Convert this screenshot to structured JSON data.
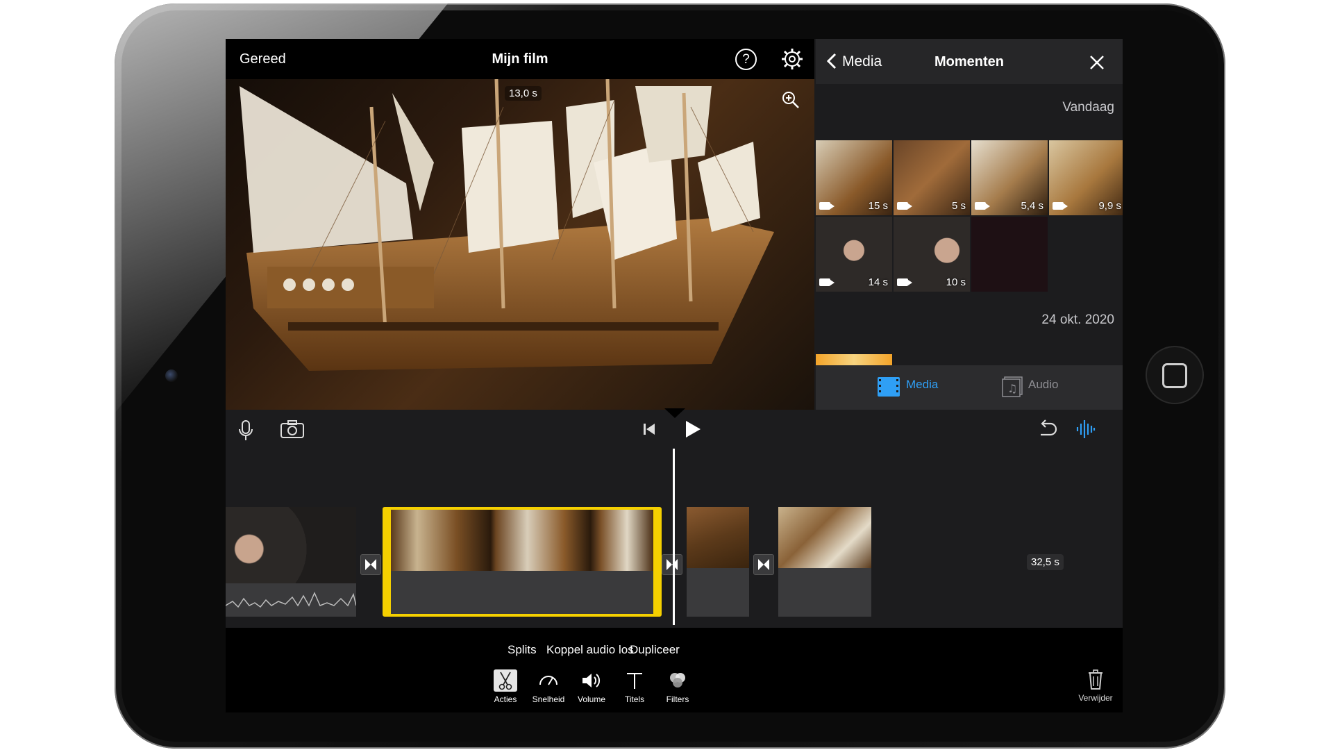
{
  "app": {
    "done_label": "Gereed",
    "project_title": "Mijn film"
  },
  "preview": {
    "time": "13,0 s"
  },
  "media_browser": {
    "back_label": "Media",
    "title": "Momenten",
    "sections": [
      {
        "date": "Vandaag",
        "items": [
          {
            "type": "video",
            "duration": "15 s"
          },
          {
            "type": "video",
            "duration": "5 s"
          },
          {
            "type": "video",
            "duration": "5,4 s"
          },
          {
            "type": "video",
            "duration": "9,9 s"
          },
          {
            "type": "video",
            "duration": "14 s"
          },
          {
            "type": "video",
            "duration": "10 s"
          }
        ]
      },
      {
        "date": "24 okt. 2020",
        "items": []
      }
    ],
    "tabs": [
      {
        "label": "Media",
        "selected": true
      },
      {
        "label": "Audio",
        "selected": false
      }
    ]
  },
  "timeline": {
    "total_duration": "32,5 s"
  },
  "edit_actions": [
    "Splits",
    "Koppel audio los",
    "Dupliceer"
  ],
  "tools": [
    {
      "label": "Acties",
      "icon": "scissors-icon",
      "selected": true
    },
    {
      "label": "Snelheid",
      "icon": "speedometer-icon",
      "selected": false
    },
    {
      "label": "Volume",
      "icon": "speaker-icon",
      "selected": false
    },
    {
      "label": "Titels",
      "icon": "text-icon",
      "selected": false
    },
    {
      "label": "Filters",
      "icon": "filters-icon",
      "selected": false
    }
  ],
  "delete_label": "Verwijder",
  "colors": {
    "accent": "#2f9ff5",
    "selection": "#f5d000",
    "toolbar": "#000000",
    "panel": "#1c1c1e"
  }
}
